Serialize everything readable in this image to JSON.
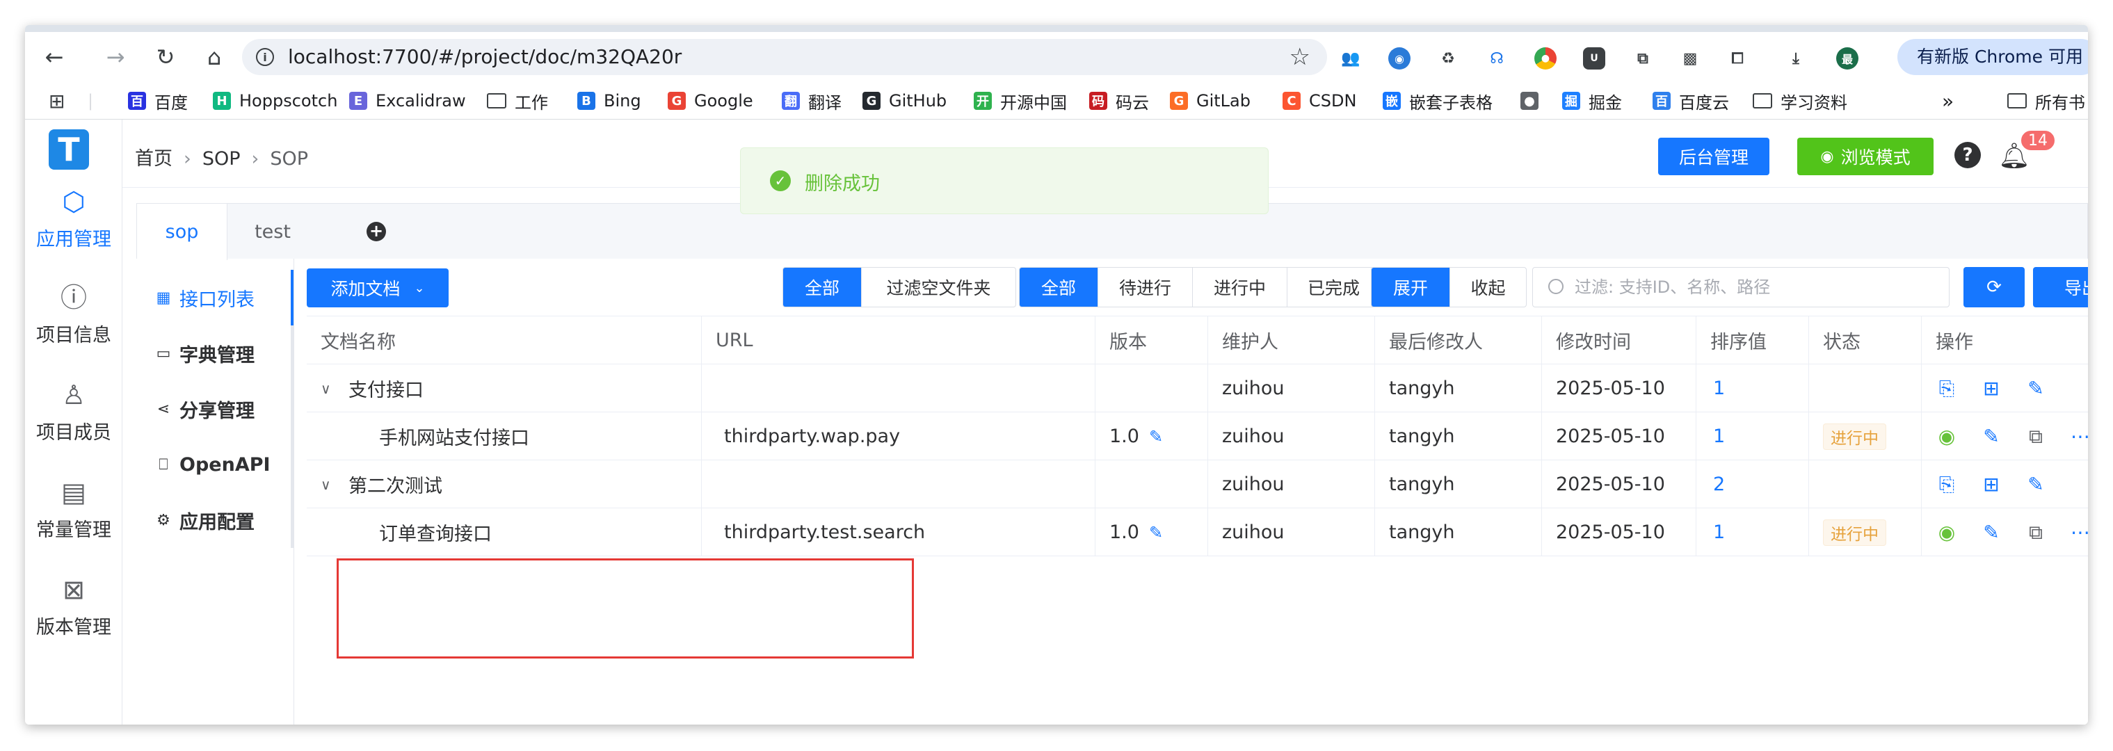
{
  "browser": {
    "url": "localhost:7700/#/project/doc/m32QA20r",
    "update_label": "有新版 Chrome 可用",
    "profile_initial": "最",
    "bookmarks": [
      {
        "label": "百度",
        "icon": "baidu-icon",
        "color": "#2932e1"
      },
      {
        "label": "Hoppscotch",
        "icon": "hoppscotch-icon",
        "color": "#10b981"
      },
      {
        "label": "Excalidraw",
        "icon": "excalidraw-icon",
        "color": "#6965db"
      },
      {
        "label": "工作",
        "icon": "folder-icon",
        "color": ""
      },
      {
        "label": "Bing",
        "icon": "bing-search-icon",
        "color": "#1a73e8"
      },
      {
        "label": "Google",
        "icon": "google-icon",
        "color": "#ea4335"
      },
      {
        "label": "翻译",
        "icon": "translate-icon",
        "color": "#4a6cf7"
      },
      {
        "label": "GitHub",
        "icon": "github-icon",
        "color": "#24292f"
      },
      {
        "label": "开源中国",
        "icon": "oschina-icon",
        "color": "#2eb24e"
      },
      {
        "label": "码云",
        "icon": "gitee-icon",
        "color": "#c71d23"
      },
      {
        "label": "GitLab",
        "icon": "gitlab-icon",
        "color": "#fc6d26"
      },
      {
        "label": "CSDN",
        "icon": "csdn-icon",
        "color": "#fc5531"
      },
      {
        "label": "嵌套子表格",
        "icon": "nested-table-icon",
        "color": "#1677ff"
      },
      {
        "label": "",
        "icon": "globe-icon",
        "color": "#5f6368"
      },
      {
        "label": "掘金",
        "icon": "juejin-icon",
        "color": "#1e80ff"
      },
      {
        "label": "百度云",
        "icon": "baidu-cloud-icon",
        "color": "#2f80ed"
      },
      {
        "label": "学习资料",
        "icon": "folder-icon",
        "color": ""
      }
    ],
    "bookmarks_more": "»",
    "all_bookmarks_label": "所有书"
  },
  "app": {
    "logo_letter": "T",
    "nav": [
      {
        "label": "应用管理",
        "icon": "cube-icon",
        "glyph": "⬡",
        "active": true
      },
      {
        "label": "项目信息",
        "icon": "info-icon",
        "glyph": "ⓘ",
        "active": false
      },
      {
        "label": "项目成员",
        "icon": "user-icon",
        "glyph": "♙",
        "active": false
      },
      {
        "label": "常量管理",
        "icon": "book-icon",
        "glyph": "▤",
        "active": false
      },
      {
        "label": "版本管理",
        "icon": "delete-doc-icon",
        "glyph": "⊠",
        "active": false
      }
    ],
    "breadcrumb": [
      "首页",
      "SOP",
      "SOP"
    ],
    "toast": "删除成功",
    "admin_label": "后台管理",
    "preview_label": "浏览模式",
    "notification_count": "14",
    "tabs": [
      "sop",
      "test"
    ],
    "subnav": [
      {
        "label": "接口列表",
        "icon": "grid-icon",
        "glyph": "▦",
        "active": true
      },
      {
        "label": "字典管理",
        "icon": "doc-icon",
        "glyph": "▭",
        "active": false
      },
      {
        "label": "分享管理",
        "icon": "share-icon",
        "glyph": "⋖",
        "active": false
      },
      {
        "label": "OpenAPI",
        "icon": "bookmark-icon",
        "glyph": "⎕",
        "active": false
      },
      {
        "label": "应用配置",
        "icon": "settings-icon",
        "glyph": "⚙",
        "active": false
      }
    ],
    "toolbar": {
      "add_doc": "添加文档",
      "filter_group1": [
        "全部",
        "过滤空文件夹"
      ],
      "filter_group2": [
        "全部",
        "待进行",
        "进行中",
        "已完成"
      ],
      "expand_group": [
        "展开",
        "收起"
      ],
      "search_placeholder": "过滤: 支持ID、名称、路径",
      "export": "导出"
    },
    "table": {
      "columns": [
        "文档名称",
        "URL",
        "版本",
        "维护人",
        "最后修改人",
        "修改时间",
        "排序值",
        "状态",
        "操作"
      ],
      "rows": [
        {
          "type": "folder",
          "name": "支付接口",
          "url": "",
          "version": "",
          "maintainer": "zuihou",
          "modifier": "tangyh",
          "time": "2025-05-10",
          "order": "1",
          "status": ""
        },
        {
          "type": "doc",
          "name": "手机网站支付接口",
          "url": "thirdparty.wap.pay",
          "version": "1.0",
          "maintainer": "zuihou",
          "modifier": "tangyh",
          "time": "2025-05-10",
          "order": "1",
          "status": "进行中"
        },
        {
          "type": "folder",
          "name": "第二次测试",
          "url": "",
          "version": "",
          "maintainer": "zuihou",
          "modifier": "tangyh",
          "time": "2025-05-10",
          "order": "2",
          "status": ""
        },
        {
          "type": "doc",
          "name": "订单查询接口",
          "url": "thirdparty.test.search",
          "version": "1.0",
          "maintainer": "zuihou",
          "modifier": "tangyh",
          "time": "2025-05-10",
          "order": "1",
          "status": "进行中"
        }
      ]
    }
  }
}
